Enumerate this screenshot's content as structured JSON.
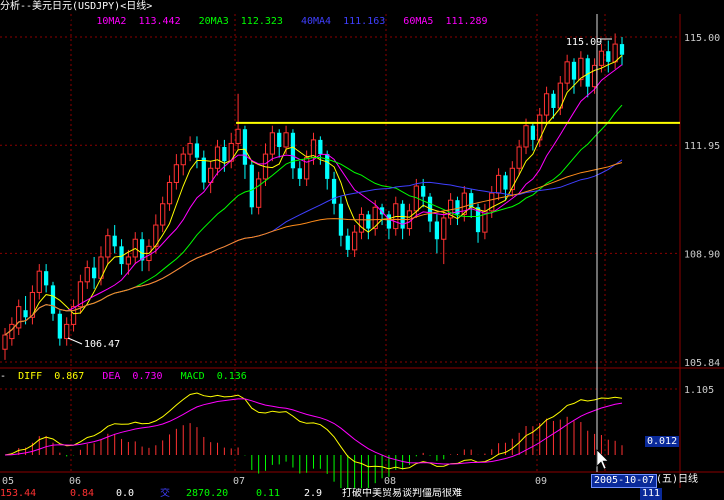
{
  "header": {
    "title": "分析--美元日元(USDJPY)<日线>"
  },
  "ma_legend": [
    {
      "label": "5MA1",
      "value": "113.834",
      "color": "#ffffff"
    },
    {
      "label": "10MA2",
      "value": "113.442",
      "color": "#ffff00"
    },
    {
      "label": "20MA3",
      "value": "112.323",
      "color": "#ff00ff"
    },
    {
      "label": "40MA4",
      "value": "111.163",
      "color": "#00ff00"
    },
    {
      "label": "60MA5",
      "value": "111.289",
      "color": "#3f3fff"
    }
  ],
  "price_axis": [
    "115.00",
    "111.95",
    "108.90",
    "105.84"
  ],
  "price_markers": {
    "high": "115.09",
    "low": "106.47"
  },
  "macd_legend": [
    {
      "label": "DIFF",
      "value": "0.867",
      "color": "#ffffff"
    },
    {
      "label": "DEA",
      "value": "0.730",
      "color": "#ffff00"
    },
    {
      "label": "MACD",
      "value": "0.136",
      "color": "#ff00ff"
    }
  ],
  "macd_axis": {
    "top": "1.105",
    "current": "0.012"
  },
  "month_labels": [
    "05",
    "06",
    "07",
    "08",
    "09",
    "10"
  ],
  "cursor": {
    "date": "2005-10-07",
    "weekday": "(五)",
    "period": "日线"
  },
  "status_bar": [
    "153.44",
    "0.84",
    "0.0",
    "交",
    "2870.20",
    "0.11",
    "2.9",
    "打破中美贸易谈判僵局很难",
    "111"
  ],
  "colors": {
    "up": "#ff3232",
    "down": "#00ffff",
    "grid": "#8b0000",
    "white": "#ffffff",
    "yellow": "#ffff00",
    "magenta": "#ff00ff",
    "green": "#00ff00",
    "blue": "#3f3fff",
    "orange": "#ff8c1a"
  },
  "chart_data": {
    "type": "candlestick",
    "ylim": [
      105.84,
      115.0
    ],
    "ticks": [
      115.0,
      111.95,
      108.9,
      105.84
    ],
    "support_line": 112.58,
    "candles": [
      [
        106.2,
        106.6,
        105.9,
        106.8
      ],
      [
        106.5,
        106.9,
        106.3,
        107.1
      ],
      [
        106.8,
        107.4,
        106.6,
        107.6
      ],
      [
        107.3,
        107.1,
        106.9,
        107.7
      ],
      [
        107.1,
        107.8,
        106.9,
        108.0
      ],
      [
        107.8,
        108.4,
        107.6,
        108.6
      ],
      [
        108.4,
        108.0,
        107.8,
        108.6
      ],
      [
        108.0,
        107.2,
        107.0,
        108.1
      ],
      [
        107.2,
        106.5,
        106.3,
        107.3
      ],
      [
        106.5,
        106.9,
        106.3,
        107.1
      ],
      [
        106.9,
        107.4,
        106.7,
        107.6
      ],
      [
        107.4,
        108.1,
        107.2,
        108.3
      ],
      [
        108.1,
        108.5,
        107.9,
        108.7
      ],
      [
        108.5,
        108.2,
        107.9,
        108.8
      ],
      [
        108.2,
        108.8,
        108.0,
        109.1
      ],
      [
        108.8,
        109.4,
        108.6,
        109.6
      ],
      [
        109.4,
        109.1,
        108.9,
        109.7
      ],
      [
        109.1,
        108.6,
        108.3,
        109.3
      ],
      [
        108.6,
        108.8,
        108.3,
        109.0
      ],
      [
        108.8,
        109.3,
        108.6,
        109.5
      ],
      [
        109.3,
        108.7,
        108.4,
        109.5
      ],
      [
        108.7,
        109.1,
        108.4,
        109.3
      ],
      [
        109.1,
        109.7,
        108.9,
        110.0
      ],
      [
        109.7,
        110.3,
        109.5,
        110.5
      ],
      [
        110.3,
        110.9,
        110.1,
        111.1
      ],
      [
        110.9,
        111.4,
        110.7,
        111.7
      ],
      [
        111.4,
        111.7,
        111.1,
        111.9
      ],
      [
        111.7,
        112.0,
        111.5,
        112.2
      ],
      [
        112.0,
        111.6,
        111.3,
        112.2
      ],
      [
        111.6,
        110.9,
        110.7,
        111.8
      ],
      [
        110.9,
        111.3,
        110.6,
        111.5
      ],
      [
        111.3,
        111.9,
        111.1,
        112.1
      ],
      [
        111.9,
        111.5,
        111.2,
        112.1
      ],
      [
        111.5,
        112.0,
        111.3,
        112.3
      ],
      [
        112.0,
        112.4,
        111.8,
        113.4
      ],
      [
        112.4,
        111.4,
        111.0,
        112.5
      ],
      [
        111.4,
        110.2,
        110.0,
        111.5
      ],
      [
        110.2,
        111.0,
        110.0,
        111.2
      ],
      [
        111.0,
        111.7,
        110.8,
        112.0
      ],
      [
        111.7,
        112.3,
        111.5,
        112.5
      ],
      [
        112.3,
        111.9,
        111.6,
        112.4
      ],
      [
        111.9,
        112.3,
        111.7,
        112.5
      ],
      [
        112.3,
        111.3,
        111.0,
        112.4
      ],
      [
        111.3,
        111.0,
        110.8,
        111.5
      ],
      [
        111.0,
        111.6,
        110.8,
        111.8
      ],
      [
        111.6,
        112.1,
        111.4,
        112.3
      ],
      [
        112.1,
        111.7,
        111.4,
        112.2
      ],
      [
        111.7,
        111.0,
        110.7,
        111.8
      ],
      [
        111.0,
        110.3,
        110.0,
        111.2
      ],
      [
        110.3,
        109.4,
        109.1,
        110.5
      ],
      [
        109.4,
        109.0,
        108.8,
        109.6
      ],
      [
        109.0,
        109.5,
        108.8,
        109.7
      ],
      [
        109.5,
        110.0,
        109.3,
        110.2
      ],
      [
        110.0,
        109.6,
        109.3,
        110.1
      ],
      [
        109.6,
        110.2,
        109.4,
        110.4
      ],
      [
        110.2,
        110.0,
        109.7,
        110.3
      ],
      [
        110.0,
        109.6,
        109.3,
        110.1
      ],
      [
        109.6,
        110.3,
        109.4,
        110.5
      ],
      [
        110.3,
        109.6,
        109.3,
        110.4
      ],
      [
        109.6,
        110.1,
        109.4,
        110.3
      ],
      [
        110.1,
        110.8,
        109.9,
        111.0
      ],
      [
        110.8,
        110.5,
        110.2,
        111.0
      ],
      [
        110.5,
        109.8,
        109.5,
        110.6
      ],
      [
        109.8,
        109.3,
        108.9,
        110.0
      ],
      [
        109.3,
        109.9,
        108.6,
        110.1
      ],
      [
        109.9,
        110.4,
        109.7,
        110.6
      ],
      [
        110.4,
        110.0,
        109.7,
        110.5
      ],
      [
        110.0,
        110.6,
        109.8,
        110.8
      ],
      [
        110.6,
        110.2,
        109.9,
        110.7
      ],
      [
        110.2,
        109.5,
        109.2,
        110.3
      ],
      [
        109.5,
        110.1,
        109.3,
        110.3
      ],
      [
        110.1,
        110.6,
        109.9,
        110.8
      ],
      [
        110.6,
        111.1,
        110.4,
        111.3
      ],
      [
        111.1,
        110.7,
        110.4,
        111.2
      ],
      [
        110.7,
        111.3,
        110.5,
        111.5
      ],
      [
        111.3,
        111.9,
        111.1,
        112.1
      ],
      [
        111.9,
        112.5,
        111.7,
        112.7
      ],
      [
        112.5,
        112.1,
        111.8,
        112.6
      ],
      [
        112.1,
        112.8,
        111.9,
        113.0
      ],
      [
        112.8,
        113.4,
        112.6,
        113.6
      ],
      [
        113.4,
        113.0,
        112.7,
        113.5
      ],
      [
        113.0,
        113.7,
        112.8,
        113.9
      ],
      [
        113.7,
        114.3,
        113.5,
        114.5
      ],
      [
        114.3,
        113.8,
        113.4,
        114.4
      ],
      [
        113.8,
        114.4,
        113.6,
        114.6
      ],
      [
        114.4,
        113.6,
        113.3,
        114.5
      ],
      [
        113.6,
        114.2,
        113.4,
        114.4
      ],
      [
        114.2,
        114.6,
        114.0,
        114.8
      ],
      [
        114.6,
        114.3,
        114.0,
        114.9
      ],
      [
        114.3,
        114.8,
        114.1,
        115.1
      ],
      [
        114.8,
        114.5,
        114.2,
        115.0
      ]
    ]
  }
}
